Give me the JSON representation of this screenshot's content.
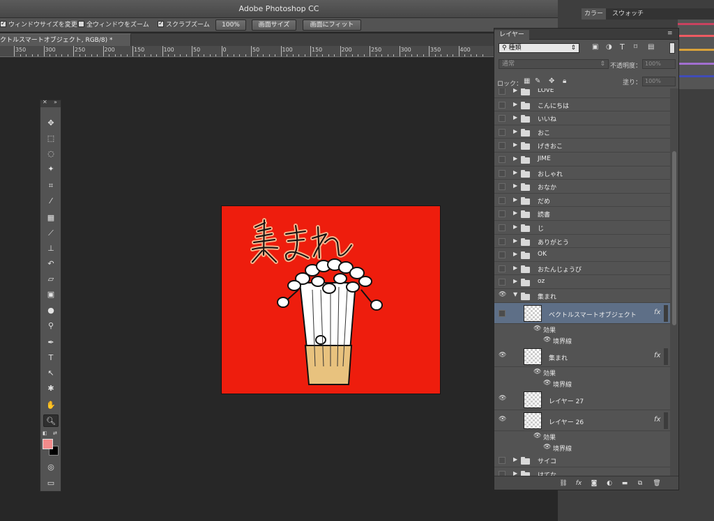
{
  "app": {
    "title": "Adobe Photoshop CC"
  },
  "options": {
    "resize_windows": "ウィンドウサイズを変更",
    "zoom_all": "全ウィンドウをズーム",
    "scrubby_zoom": "スクラブズーム",
    "btn_100": "100%",
    "btn_fit_screen": "画面サイズ",
    "btn_fill_screen": "画面にフィット"
  },
  "document": {
    "tab_label": "クトルスマートオブジェクト, RGB/8) *"
  },
  "ruler": {
    "labels": [
      "350",
      "300",
      "250",
      "200",
      "150",
      "100",
      "50",
      "0",
      "50",
      "100",
      "150",
      "200",
      "250",
      "300",
      "350",
      "400"
    ]
  },
  "colors": {
    "canvas": "#ee1d0d",
    "selected_row": "#5e6f87",
    "foreground": "#f28b8b",
    "background": "#000000"
  },
  "right_panel": {
    "tab_color": "カラー",
    "tab_swatches": "スウォッチ"
  },
  "layers_panel": {
    "tab": "レイヤー",
    "filter_kind": "種類",
    "blend_mode": "通常",
    "opacity_label": "不透明度：",
    "opacity_value": "100%",
    "lock_label": "ロック：",
    "fill_label": "塗り：",
    "fill_value": "100%",
    "groups_top": [
      "LOVE",
      "こんにちは",
      "いいね",
      "おこ",
      "げきおこ",
      "JIME",
      "おしゃれ",
      "おなか",
      "だめ",
      "読書",
      "じ",
      "ありがとう",
      "OK",
      "おたんじょうび",
      "oz"
    ],
    "open_group": "集まれ",
    "layer_smart": "ベクトルスマートオブジェクト",
    "layer_atsumare": "集まれ",
    "layer_27": "レイヤー 27",
    "layer_26": "レイヤー 26",
    "effect_label": "効果",
    "stroke_label": "境界線",
    "fx": "fx",
    "groups_bottom": [
      "サイコ",
      "はてな"
    ]
  }
}
